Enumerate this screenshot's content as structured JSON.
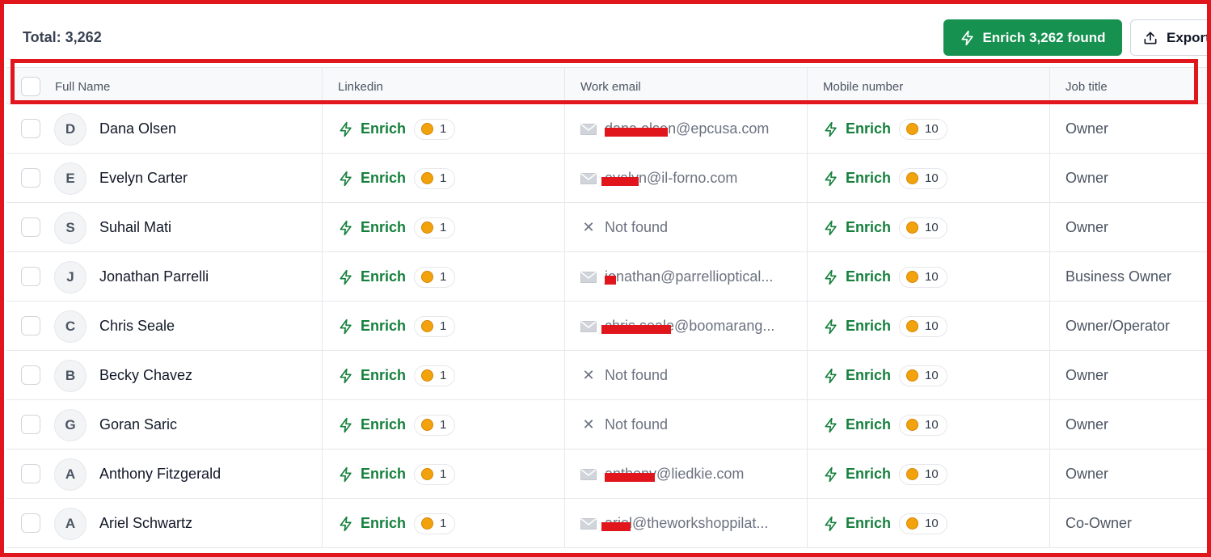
{
  "toolbar": {
    "total_label": "Total: 3,262",
    "enrich_button": "Enrich 3,262 found",
    "export_button": "Export"
  },
  "columns": [
    "Full Name",
    "Linkedin",
    "Work email",
    "Mobile number",
    "Job title"
  ],
  "enrich_label": "Enrich",
  "not_found_label": "Not found",
  "colors": {
    "accent_green": "#16914f",
    "enrich_text": "#15803d",
    "coin": "#f2a20c",
    "annotation_red": "#e0161c"
  },
  "rows": [
    {
      "initial": "D",
      "name": "Dana Olsen",
      "linkedin_credits": "1",
      "email": "dana.olsen@epcusa.com",
      "email_found": true,
      "mobile_credits": "10",
      "job_title": "Owner"
    },
    {
      "initial": "E",
      "name": "Evelyn Carter",
      "linkedin_credits": "1",
      "email": "evelyn@il-forno.com",
      "email_found": true,
      "mobile_credits": "10",
      "job_title": "Owner"
    },
    {
      "initial": "S",
      "name": "Suhail Mati",
      "linkedin_credits": "1",
      "email": "",
      "email_found": false,
      "mobile_credits": "10",
      "job_title": "Owner"
    },
    {
      "initial": "J",
      "name": "Jonathan Parrelli",
      "linkedin_credits": "1",
      "email": "jonathan@parrellioptical...",
      "email_found": true,
      "mobile_credits": "10",
      "job_title": "Business Owner"
    },
    {
      "initial": "C",
      "name": "Chris Seale",
      "linkedin_credits": "1",
      "email": "chris.seale@boomarang...",
      "email_found": true,
      "mobile_credits": "10",
      "job_title": "Owner/Operator"
    },
    {
      "initial": "B",
      "name": "Becky Chavez",
      "linkedin_credits": "1",
      "email": "",
      "email_found": false,
      "mobile_credits": "10",
      "job_title": "Owner"
    },
    {
      "initial": "G",
      "name": "Goran Saric",
      "linkedin_credits": "1",
      "email": "",
      "email_found": false,
      "mobile_credits": "10",
      "job_title": "Owner"
    },
    {
      "initial": "A",
      "name": "Anthony Fitzgerald",
      "linkedin_credits": "1",
      "email": "anthony@liedkie.com",
      "email_found": true,
      "mobile_credits": "10",
      "job_title": "Owner"
    },
    {
      "initial": "A",
      "name": "Ariel Schwartz",
      "linkedin_credits": "1",
      "email": "ariel@theworkshoppilat...",
      "email_found": true,
      "mobile_credits": "10",
      "job_title": "Co-Owner"
    }
  ]
}
